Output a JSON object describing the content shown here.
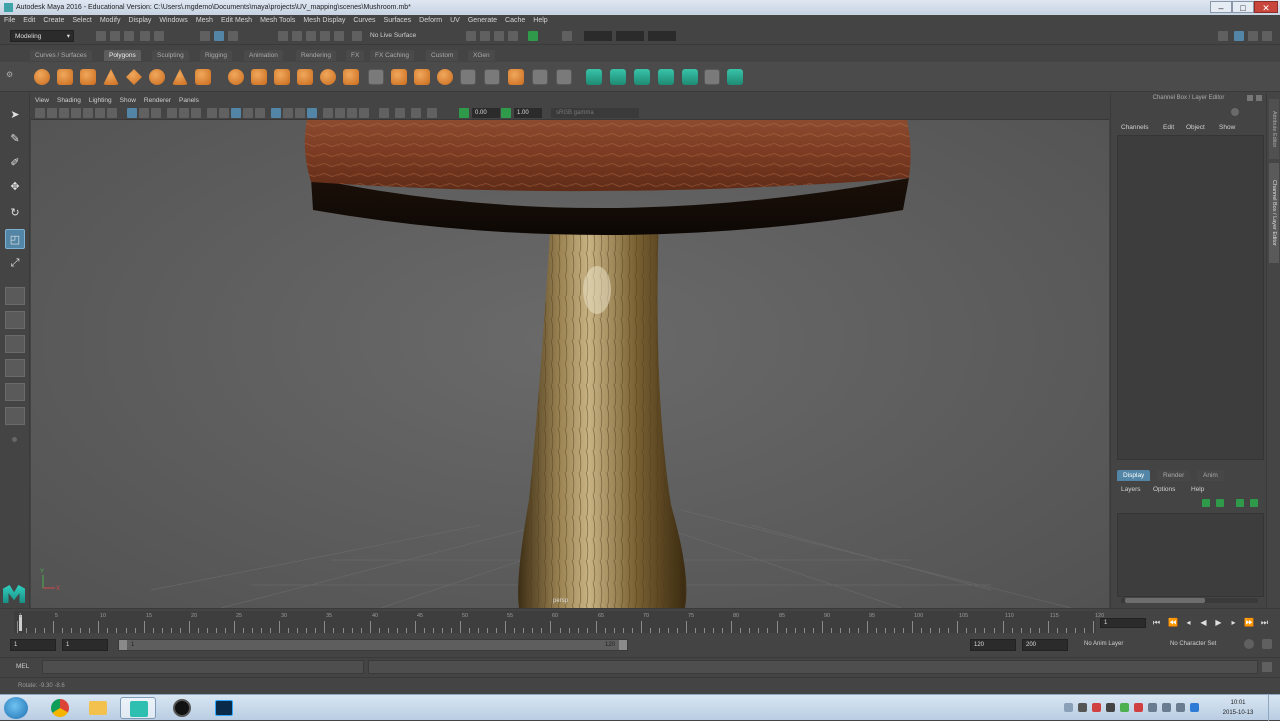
{
  "window": {
    "title": "Autodesk Maya 2016 - Educational Version: C:\\Users\\.mgdemo\\Documents\\maya\\projects\\UV_mapping\\scenes\\Mushroom.mb*",
    "controls": {
      "minimize": "–",
      "maximize": "□",
      "close": "✕"
    }
  },
  "menubar": [
    "File",
    "Edit",
    "Create",
    "Select",
    "Modify",
    "Display",
    "Windows",
    "Mesh",
    "Edit Mesh",
    "Mesh Tools",
    "Mesh Display",
    "Curves",
    "Surfaces",
    "Deform",
    "UV",
    "Generate",
    "Cache",
    "Help"
  ],
  "statusline": {
    "menuset": "Modeling",
    "live_surface": "No Live Surface"
  },
  "shelf_tabs": [
    "Curves / Surfaces",
    "Polygons",
    "Sculpting",
    "Rigging",
    "Animation",
    "Rendering",
    "FX",
    "FX Caching",
    "Custom",
    "XGen"
  ],
  "shelf_active": "Polygons",
  "panel_menu": [
    "View",
    "Shading",
    "Lighting",
    "Show",
    "Renderer",
    "Panels"
  ],
  "panel_toolbar": {
    "value_a": "0.00",
    "value_b": "1.00",
    "color_space": "sRGB gamma"
  },
  "viewport": {
    "camera_label": "persp",
    "axis_y": "Y",
    "axis_x": "X"
  },
  "channel_box": {
    "title": "Channel Box / Layer Editor",
    "menu": [
      "Channels",
      "Edit",
      "Object",
      "Show"
    ]
  },
  "layer_editor": {
    "tabs": [
      "Display",
      "Render",
      "Anim"
    ],
    "active_tab": "Display",
    "menu": [
      "Layers",
      "Options",
      "Help"
    ]
  },
  "side_tabs": [
    "Attribute Editor",
    "Channel Box / Layer Editor"
  ],
  "timeslider": {
    "ticks": [
      "1",
      "5",
      "10",
      "15",
      "20",
      "25",
      "30",
      "35",
      "40",
      "45",
      "50",
      "55",
      "60",
      "65",
      "70",
      "75",
      "80",
      "85",
      "90",
      "95",
      "100",
      "105",
      "110",
      "115",
      "120"
    ],
    "current_frame": "1"
  },
  "range": {
    "start": "1",
    "playback_start": "1",
    "range_start_label": "1",
    "range_end_label": "120",
    "playback_end": "120",
    "end": "200",
    "anim_layer": "No Anim Layer",
    "character_set": "No Character Set"
  },
  "command_line": {
    "label": "MEL"
  },
  "help_line": {
    "text": "Rotate: -9.30   -8.6"
  },
  "taskbar": {
    "clock_time": "10:01",
    "clock_date": "2015-10-13"
  }
}
